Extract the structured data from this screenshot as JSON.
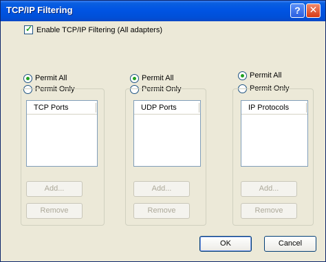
{
  "title": "TCP/IP Filtering",
  "title_buttons": {
    "help": "?",
    "close": "✕"
  },
  "enable": {
    "label": "Enable TCP/IP Filtering (All adapters)",
    "checked": true
  },
  "groups": [
    {
      "permit_all": "Permit All",
      "permit_only": "Permit Only",
      "list_header": "TCP Ports",
      "add": "Add...",
      "remove": "Remove"
    },
    {
      "permit_all": "Permit All",
      "permit_only": "Permit Only",
      "list_header": "UDP Ports",
      "add": "Add...",
      "remove": "Remove"
    },
    {
      "permit_all": "Permit All",
      "permit_only": "Permit Only",
      "list_header": "IP Protocols",
      "add": "Add...",
      "remove": "Remove"
    }
  ],
  "ok": "OK",
  "cancel": "Cancel",
  "colors": {
    "titlebar": "#0054e3",
    "face": "#ece9d8",
    "check": "#21a121"
  }
}
